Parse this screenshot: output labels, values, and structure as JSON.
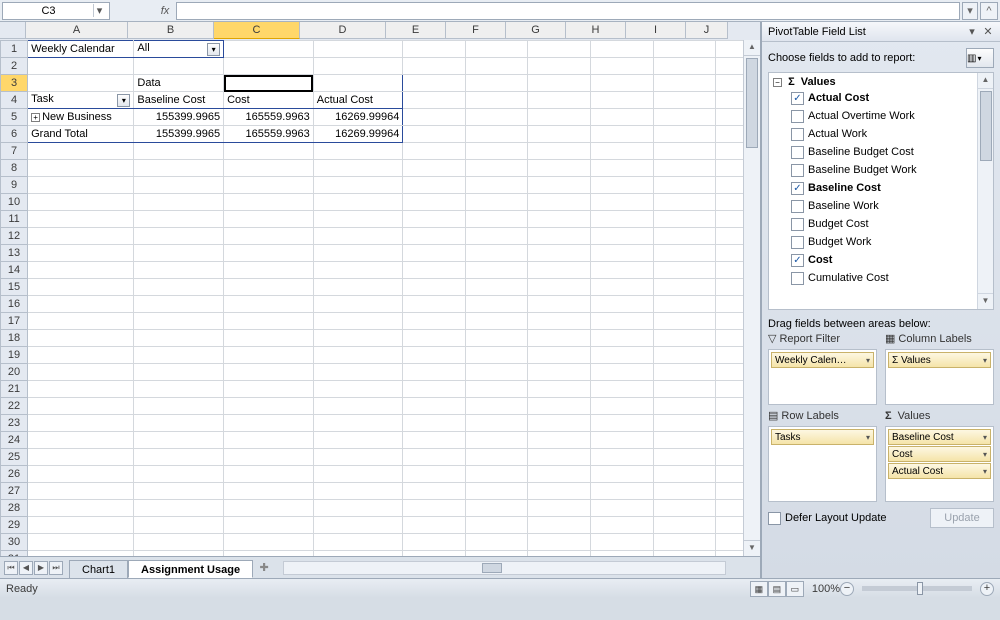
{
  "nameBox": {
    "value": "C3"
  },
  "formulaBar": {
    "fxLabel": "fx",
    "value": ""
  },
  "columns": [
    {
      "label": "A",
      "width": 102
    },
    {
      "label": "B",
      "width": 86
    },
    {
      "label": "C",
      "width": 86
    },
    {
      "label": "D",
      "width": 86
    },
    {
      "label": "E",
      "width": 60
    },
    {
      "label": "F",
      "width": 60
    },
    {
      "label": "G",
      "width": 60
    },
    {
      "label": "H",
      "width": 60
    },
    {
      "label": "I",
      "width": 60
    },
    {
      "label": "J",
      "width": 42
    }
  ],
  "rows": {
    "count": 32,
    "selected": 3
  },
  "cells": {
    "A1": {
      "text": "Weekly Calendar"
    },
    "B1": {
      "text": "All",
      "hasDropdown": true
    },
    "B3": {
      "text": "Data"
    },
    "A4": {
      "text": "Task",
      "hasDropdown": true
    },
    "B4": {
      "text": "Baseline Cost"
    },
    "C4": {
      "text": "Cost"
    },
    "D4": {
      "text": "Actual Cost"
    },
    "A5": {
      "text": "New Business",
      "hasExpand": true
    },
    "B5": {
      "text": "155399.9965"
    },
    "C5": {
      "text": "165559.9963"
    },
    "D5": {
      "text": "16269.99964"
    },
    "A6": {
      "text": "Grand Total"
    },
    "B6": {
      "text": "155399.9965"
    },
    "C6": {
      "text": "165559.9963"
    },
    "D6": {
      "text": "16269.99964"
    }
  },
  "sheetTabs": {
    "nav": [
      "⏮",
      "◀",
      "▶",
      "⏭"
    ],
    "tabs": [
      {
        "label": "Chart1",
        "active": false
      },
      {
        "label": "Assignment Usage",
        "active": true
      }
    ],
    "insertIcon": "✚"
  },
  "panel": {
    "title": "PivotTable Field List",
    "chooseLabel": "Choose fields to add to report:",
    "treeRoot": "Values",
    "fields": [
      {
        "label": "Actual Cost",
        "checked": true
      },
      {
        "label": "Actual Overtime Work",
        "checked": false
      },
      {
        "label": "Actual Work",
        "checked": false
      },
      {
        "label": "Baseline Budget Cost",
        "checked": false
      },
      {
        "label": "Baseline Budget Work",
        "checked": false
      },
      {
        "label": "Baseline Cost",
        "checked": true
      },
      {
        "label": "Baseline Work",
        "checked": false
      },
      {
        "label": "Budget Cost",
        "checked": false
      },
      {
        "label": "Budget Work",
        "checked": false
      },
      {
        "label": "Cost",
        "checked": true
      },
      {
        "label": "Cumulative Cost",
        "checked": false
      }
    ],
    "dragLabel": "Drag fields between areas below:",
    "areas": {
      "reportFilter": {
        "title": "Report Filter",
        "chips": [
          "Weekly Calen…"
        ]
      },
      "columnLabels": {
        "title": "Column Labels",
        "chips": [
          "Values"
        ],
        "sigma": "Σ"
      },
      "rowLabels": {
        "title": "Row Labels",
        "chips": [
          "Tasks"
        ]
      },
      "values": {
        "title": "Values",
        "sigma": "Σ",
        "chips": [
          "Baseline Cost",
          "Cost",
          "Actual Cost"
        ]
      }
    },
    "deferLabel": "Defer Layout Update",
    "updateLabel": "Update"
  },
  "status": {
    "ready": "Ready",
    "zoom": "100%"
  }
}
